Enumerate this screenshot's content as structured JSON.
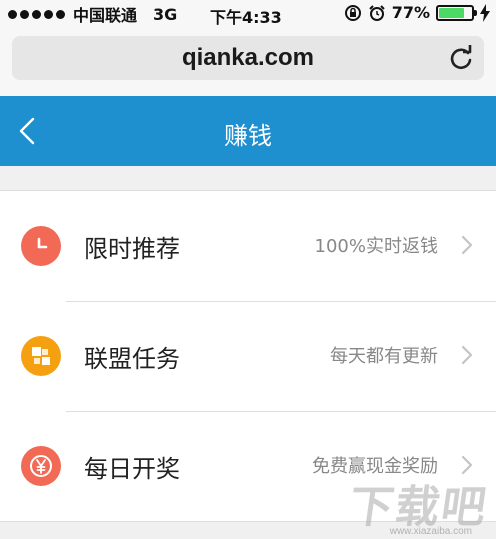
{
  "status_bar": {
    "carrier": "中国联通",
    "network": "3G",
    "time": "下午4:33",
    "battery": "77%",
    "battery_level": 0.77,
    "icons": [
      "rotation-lock-icon",
      "alarm-icon",
      "battery-icon",
      "charging-icon"
    ]
  },
  "browser": {
    "url": "qianka.com",
    "reload_icon": "reload-icon"
  },
  "navbar": {
    "title": "赚钱",
    "back_icon": "back-chevron-icon"
  },
  "list": {
    "items": [
      {
        "label": "限时推荐",
        "subtitle": "100%实时返钱",
        "icon": "clock-icon",
        "color": "#f26a56"
      },
      {
        "label": "联盟任务",
        "subtitle": "每天都有更新",
        "icon": "puzzle-icon",
        "color": "#f5a011"
      },
      {
        "label": "每日开奖",
        "subtitle": "免费赢现金奖励",
        "icon": "yen-coin-icon",
        "color": "#f26a56"
      }
    ]
  },
  "watermark": {
    "text": "下载吧",
    "url": "www.xiazaiba.com"
  },
  "colors": {
    "nav_bg": "#1e8fcf",
    "page_bg": "#f0f0f0",
    "battery_green": "#4cd964"
  }
}
